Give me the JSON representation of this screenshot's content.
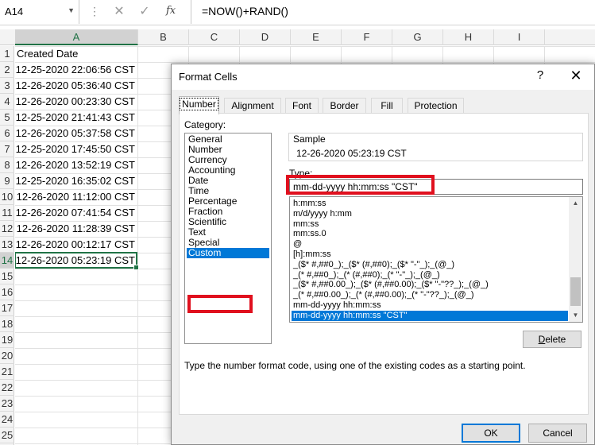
{
  "formula_bar": {
    "name_box": "A14",
    "fx_label": "fx",
    "formula": "=NOW()+RAND()"
  },
  "sheet": {
    "columns": [
      "A",
      "B",
      "C",
      "D",
      "E",
      "F",
      "G",
      "H",
      "I"
    ],
    "selected_column": "A",
    "rows": [
      "1",
      "2",
      "3",
      "4",
      "5",
      "6",
      "7",
      "8",
      "9",
      "10",
      "11",
      "12",
      "13",
      "14",
      "15",
      "16",
      "17",
      "18",
      "19",
      "20",
      "21",
      "22",
      "23",
      "24",
      "25"
    ],
    "selected_row": "14",
    "column_a": {
      "header": "Created Date",
      "values": [
        "12-25-2020 22:06:56 CST",
        "12-26-2020 05:36:40 CST",
        "12-26-2020 00:23:30 CST",
        "12-25-2020 21:41:43 CST",
        "12-26-2020 05:37:58 CST",
        "12-25-2020 17:45:50 CST",
        "12-26-2020 13:52:19 CST",
        "12-25-2020 16:35:02 CST",
        "12-26-2020 11:12:00 CST",
        "12-26-2020 07:41:54 CST",
        "12-26-2020 11:28:39 CST",
        "12-26-2020 00:12:17 CST",
        "12-26-2020 05:23:19 CST"
      ]
    }
  },
  "dialog": {
    "title": "Format Cells",
    "help": "?",
    "close": "✕",
    "tabs": [
      "Number",
      "Alignment",
      "Font",
      "Border",
      "Fill",
      "Protection"
    ],
    "active_tab": "Number",
    "category_label": "Category:",
    "categories": [
      "General",
      "Number",
      "Currency",
      "Accounting",
      "Date",
      "Time",
      "Percentage",
      "Fraction",
      "Scientific",
      "Text",
      "Special",
      "Custom"
    ],
    "selected_category": "Custom",
    "sample_label": "Sample",
    "sample_value": "12-26-2020 05:23:19 CST",
    "type_label": "Type:",
    "type_value": "mm-dd-yyyy hh:mm:ss \"CST\"",
    "formats": [
      "h:mm:ss",
      "m/d/yyyy h:mm",
      "mm:ss",
      "mm:ss.0",
      "@",
      "[h]:mm:ss",
      "_($* #,##0_);_($* (#,##0);_($* \"-\"_);_(@_)",
      "_(* #,##0_);_(* (#,##0);_(* \"-\"_);_(@_)",
      "_($* #,##0.00_);_($* (#,##0.00);_($* \"-\"??_);_(@_)",
      "_(* #,##0.00_);_(* (#,##0.00);_(* \"-\"??_);_(@_)",
      "mm-dd-yyyy hh:mm:ss",
      "mm-dd-yyyy hh:mm:ss \"CST\""
    ],
    "selected_format": "mm-dd-yyyy hh:mm:ss \"CST\"",
    "delete_label_underlined": "D",
    "delete_label_rest": "elete",
    "hint": "Type the number format code, using one of the existing codes as a starting point.",
    "ok_label": "OK",
    "cancel_label": "Cancel"
  },
  "colors": {
    "excel_green": "#217346",
    "selection_blue": "#0078d7",
    "annotation_red": "#e0101e"
  }
}
